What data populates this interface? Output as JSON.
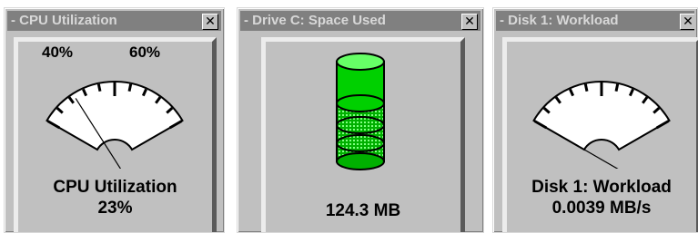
{
  "widgets": [
    {
      "title": "- CPU Utilization",
      "close_glyph": "✕",
      "gauge_left_label": "40%",
      "gauge_right_label": "60%",
      "label": "CPU Utilization",
      "value": "23%",
      "gauge_level": 0.23
    },
    {
      "title": "- Drive C: Space Used",
      "close_glyph": "✕",
      "value": "124.3 MB",
      "icon": "disk-cylinder-icon"
    },
    {
      "title": "- Disk 1: Workload",
      "close_glyph": "✕",
      "label": "Disk 1: Workload",
      "value": "0.0039 MB/s",
      "gauge_level": 0.0
    }
  ],
  "colors": {
    "panel": "#c0c0c0",
    "titlebar": "#808080",
    "cylinder_green": "#00c800",
    "cylinder_light": "#44ff44"
  }
}
